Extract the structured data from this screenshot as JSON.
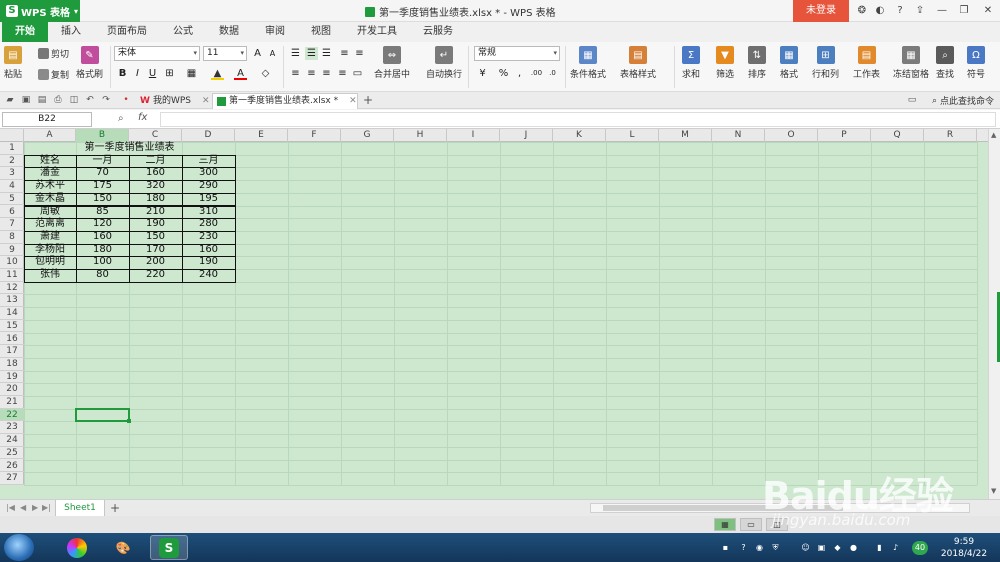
{
  "app": {
    "name": "WPS 表格",
    "doc_title": "第一季度销售业绩表.xlsx * - WPS 表格",
    "login": "未登录"
  },
  "menu": [
    "开始",
    "插入",
    "页面布局",
    "公式",
    "数据",
    "审阅",
    "视图",
    "开发工具",
    "云服务"
  ],
  "ribbon": {
    "paste": "粘贴",
    "cut": "剪切",
    "copy": "复制",
    "format_painter": "格式刷",
    "font_name": "宋体",
    "font_size": "11",
    "merge_center": "合并居中",
    "wrap_text": "自动换行",
    "number_format": "常规",
    "conditional_format": "条件格式",
    "table_style": "表格样式",
    "sum": "求和",
    "filter": "筛选",
    "sort": "排序",
    "format": "格式",
    "row_col": "行和列",
    "worksheet": "工作表",
    "freeze": "冻结窗格",
    "find": "查找",
    "symbol": "符号"
  },
  "doc_tabs": {
    "my_wps": "我的WPS",
    "current": "第一季度销售业绩表.xlsx *",
    "find_cmd": "点此查找命令"
  },
  "formula": {
    "name_box": "B22",
    "fx": "fx",
    "value": ""
  },
  "columns": [
    "A",
    "B",
    "C",
    "D",
    "E",
    "F",
    "G",
    "H",
    "I",
    "J",
    "K",
    "L",
    "M",
    "N",
    "O",
    "P",
    "Q",
    "R"
  ],
  "rows": [
    "1",
    "2",
    "3",
    "4",
    "5",
    "6",
    "7",
    "8",
    "9",
    "10",
    "11",
    "12",
    "13",
    "14",
    "15",
    "16",
    "17",
    "18",
    "19",
    "20",
    "21",
    "22",
    "23",
    "24",
    "25",
    "26",
    "27"
  ],
  "selection": {
    "col": "B",
    "row": "22"
  },
  "sheet": {
    "title": "第一季度销售业绩表",
    "headers": [
      "姓名",
      "一月",
      "二月",
      "三月"
    ],
    "records": [
      [
        "潘金",
        "70",
        "160",
        "300"
      ],
      [
        "苏术平",
        "175",
        "320",
        "290"
      ],
      [
        "金木晶",
        "150",
        "180",
        "195"
      ],
      [
        "周敏",
        "85",
        "210",
        "310"
      ],
      [
        "范离离",
        "120",
        "190",
        "280"
      ],
      [
        "萧建",
        "160",
        "150",
        "230"
      ],
      [
        "李杨阳",
        "180",
        "170",
        "160"
      ],
      [
        "包明明",
        "100",
        "200",
        "190"
      ],
      [
        "张伟",
        "80",
        "220",
        "240"
      ]
    ]
  },
  "sheet_tabs": [
    "Sheet1"
  ],
  "taskbar": {
    "clock_time": "9:59",
    "clock_date": "2018/4/22",
    "badge": "40"
  },
  "watermark": {
    "text": "Baidu经验",
    "url": "jingyan.baidu.com"
  },
  "colors": {
    "accent": "#1f9a3d",
    "login": "#e6543c",
    "grid_bg": "#cde8cf"
  }
}
